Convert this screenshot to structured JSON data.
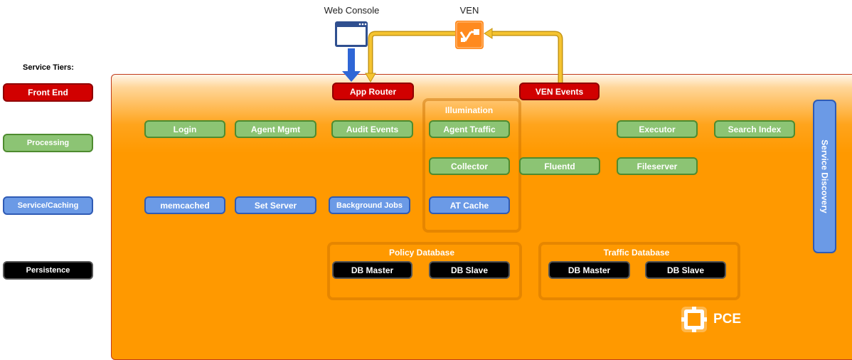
{
  "top_nodes": {
    "web_console": "Web Console",
    "ven": "VEN"
  },
  "tiers": {
    "title": "Service Tiers:",
    "front_end": "Front End",
    "processing": "Processing",
    "service_caching": "Service/Caching",
    "persistence": "Persistence"
  },
  "front_end": {
    "app_router": "App Router",
    "ven_events": "VEN Events"
  },
  "processing": {
    "login": "Login",
    "agent_mgmt": "Agent Mgmt",
    "audit_events": "Audit Events",
    "agent_traffic": "Agent Traffic",
    "executor": "Executor",
    "search_index": "Search Index",
    "collector": "Collector",
    "fluentd": "Fluentd",
    "fileserver": "Fileserver"
  },
  "caching": {
    "memcached": "memcached",
    "set_server": "Set Server",
    "background_jobs": "Background Jobs",
    "at_cache": "AT Cache"
  },
  "illumination": {
    "title": "Illumination"
  },
  "policy_db": {
    "title": "Policy Database",
    "master": "DB Master",
    "slave": "DB Slave"
  },
  "traffic_db": {
    "title": "Traffic Database",
    "master": "DB Master",
    "slave": "DB Slave"
  },
  "service_discovery": "Service Discovery",
  "pce_label": "PCE",
  "colors": {
    "front_end": "#d10000",
    "processing": "#8cc474",
    "service_caching": "#6b9ae6",
    "persistence": "#000000",
    "container": "#ff9900",
    "arrow_blue": "#3a6fe0",
    "arrow_yellow": "#f2c12e"
  }
}
